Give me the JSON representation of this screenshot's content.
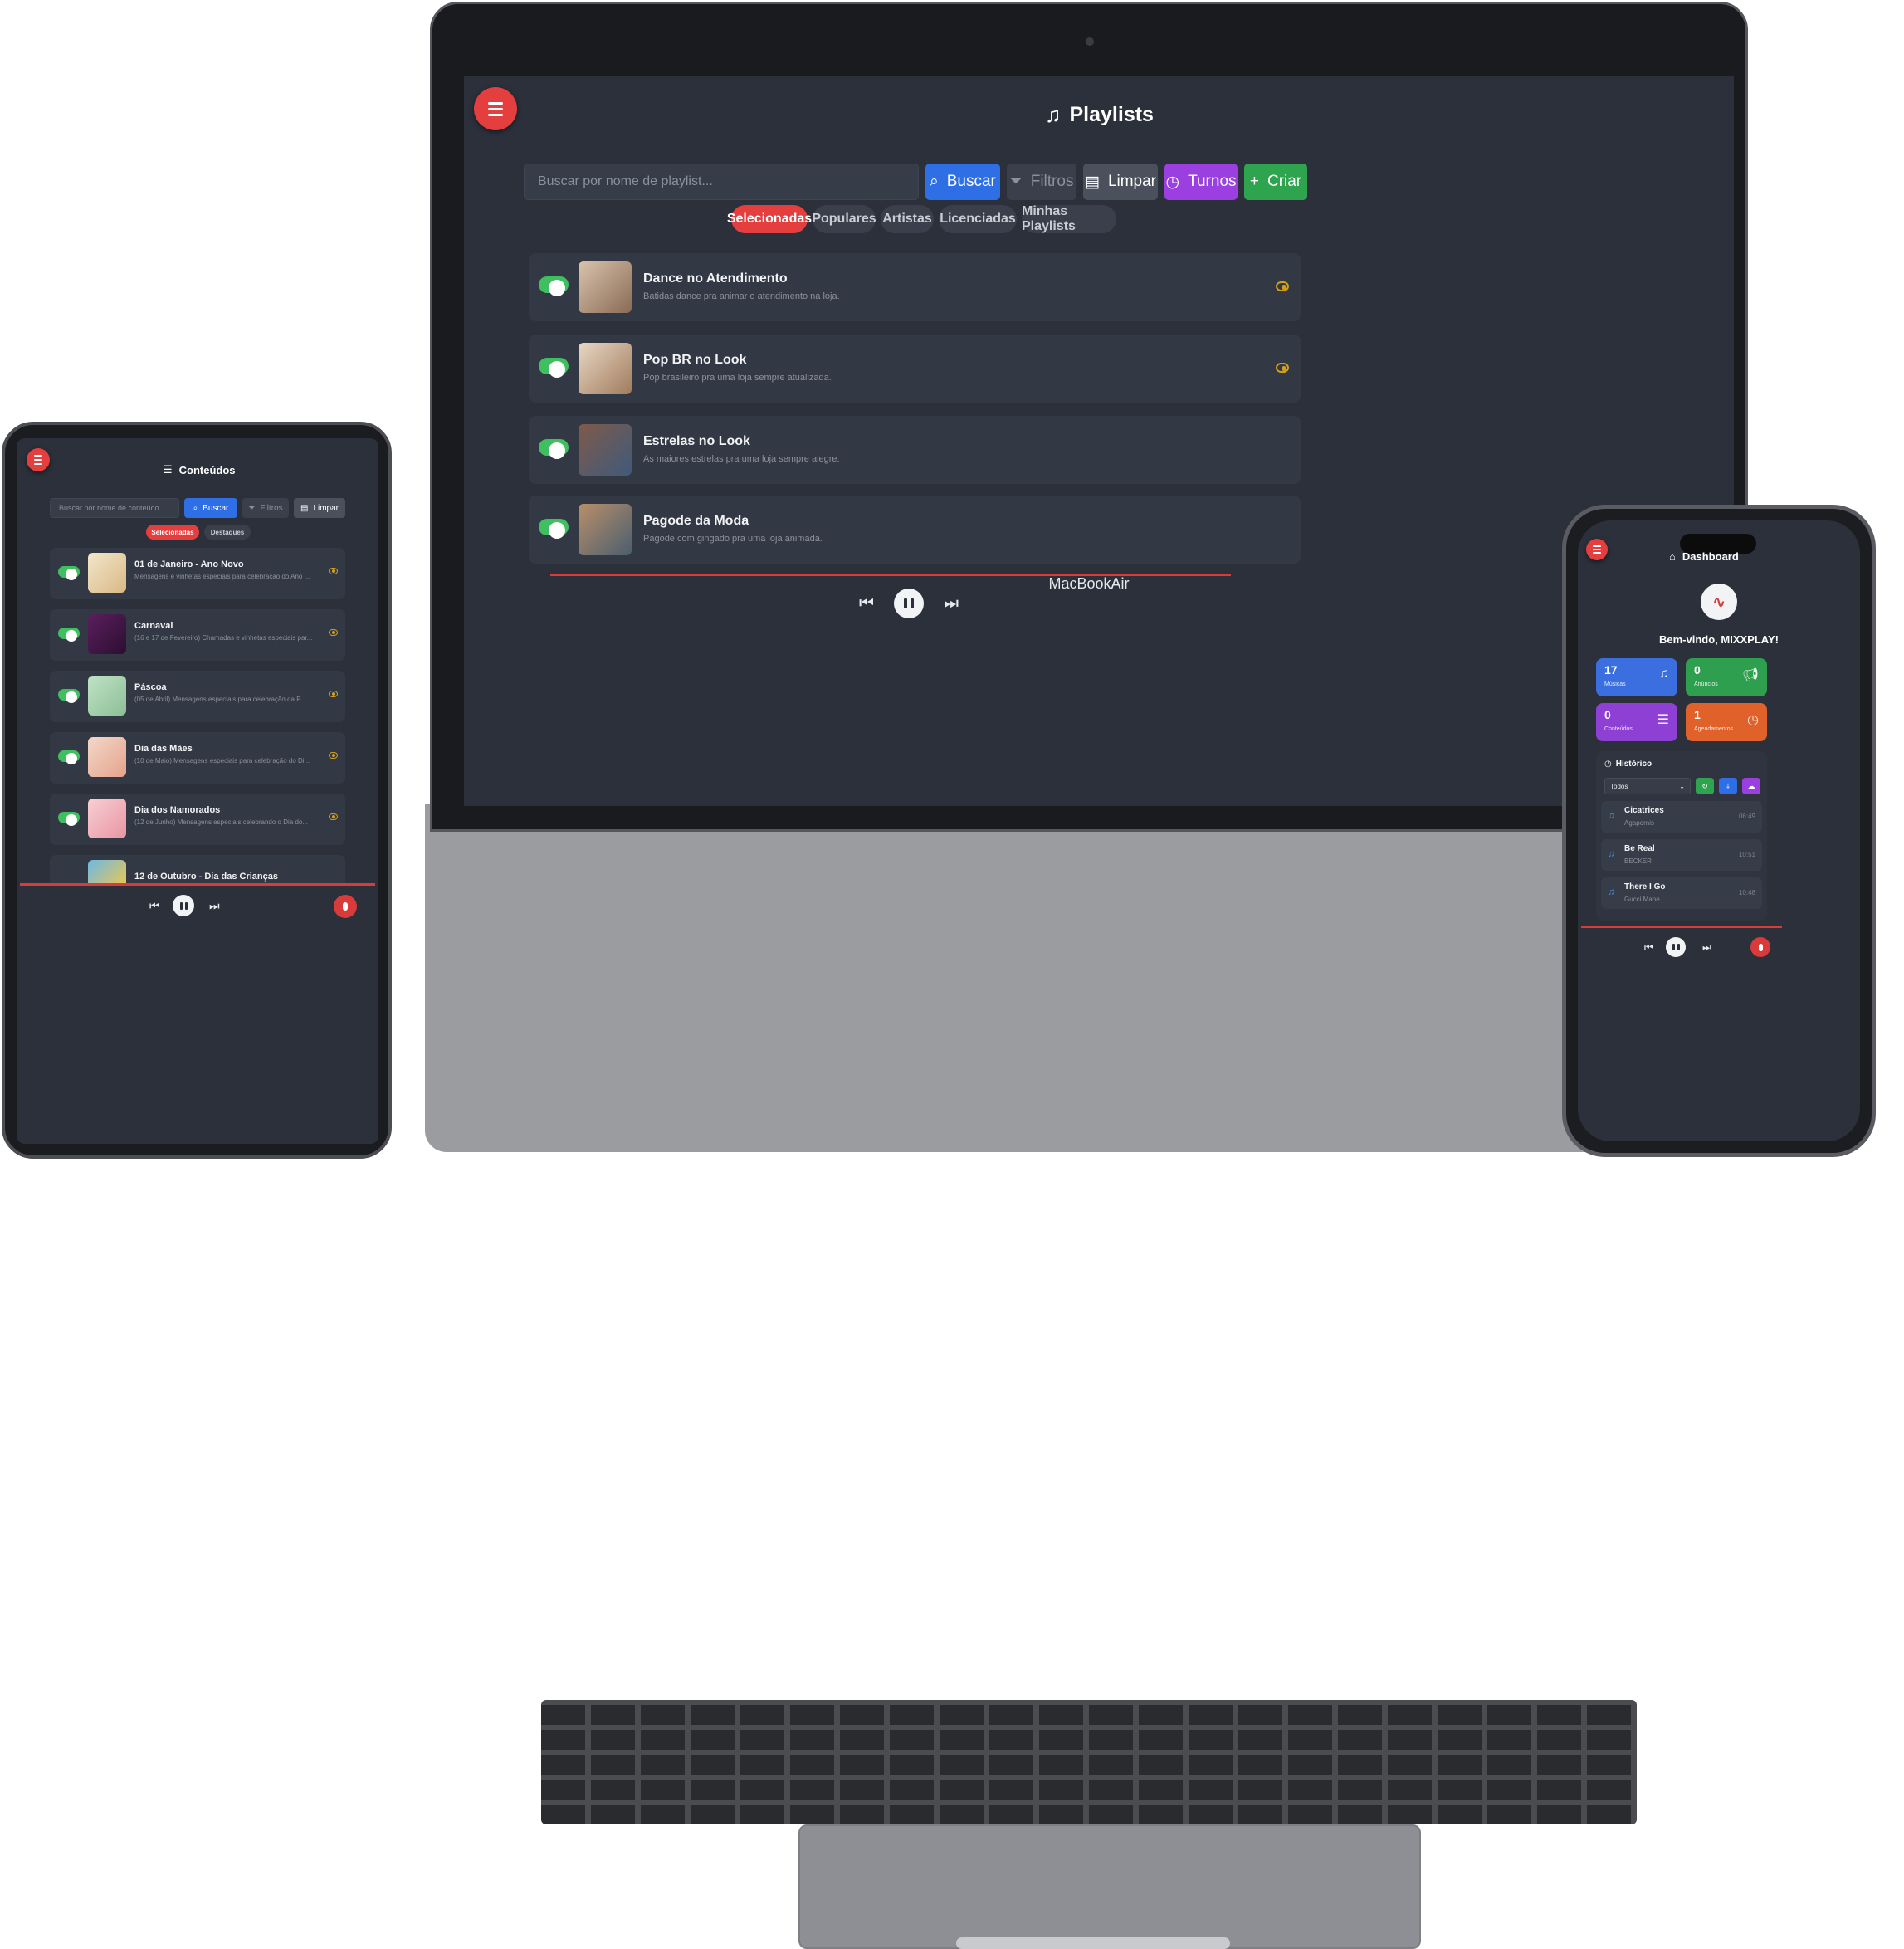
{
  "laptop": {
    "brand": "MacBookAir",
    "title": "Playlists",
    "search_placeholder": "Buscar por nome de playlist...",
    "buttons": {
      "buscar": "Buscar",
      "filtros": "Filtros",
      "limpar": "Limpar",
      "turnos": "Turnos",
      "criar": "Criar"
    },
    "tabs": [
      "Selecionadas",
      "Populares",
      "Artistas",
      "Licenciadas",
      "Minhas Playlists"
    ],
    "playlists": [
      {
        "title": "Dance no Atendimento",
        "subtitle": "Batidas dance pra animar o atendimento na loja."
      },
      {
        "title": "Pop BR no Look",
        "subtitle": "Pop brasileiro pra uma loja sempre atualizada."
      },
      {
        "title": "Estrelas no Look",
        "subtitle": "As maiores estrelas pra uma loja sempre alegre."
      },
      {
        "title": "Pagode da Moda",
        "subtitle": "Pagode com gingado pra uma loja animada."
      }
    ]
  },
  "tablet": {
    "title": "Conteúdos",
    "search_placeholder": "Buscar por nome de conteúdo...",
    "buttons": {
      "buscar": "Buscar",
      "filtros": "Filtros",
      "limpar": "Limpar"
    },
    "tabs": [
      "Selecionadas",
      "Destaques"
    ],
    "items": [
      {
        "title": "01 de Janeiro - Ano Novo",
        "subtitle": "Mensagens e vinhetas especiais para celebração do Ano ..."
      },
      {
        "title": "Carnaval",
        "subtitle": "(16 e 17 de Fevereiro) Chamadas e vinhetas especiais par..."
      },
      {
        "title": "Páscoa",
        "subtitle": "(05 de Abril) Mensagens especiais para celebração da P..."
      },
      {
        "title": "Dia das Mães",
        "subtitle": "(10 de Maio) Mensagens especiais para celebração do Di..."
      },
      {
        "title": "Dia dos Namorados",
        "subtitle": "(12 de Junho) Mensagens especiais celebrando o Dia do..."
      },
      {
        "title": "12 de Outubro - Dia das Crianças",
        "subtitle": ""
      }
    ]
  },
  "phone": {
    "title": "Dashboard",
    "welcome": "Bem-vindo, MIXXPLAY!",
    "stats": [
      {
        "value": "17",
        "label": "Músicas",
        "icon": "music-icon",
        "color": "#3b6fe0"
      },
      {
        "value": "0",
        "label": "Anúncios",
        "icon": "megaphone-icon",
        "color": "#2e9e4f"
      },
      {
        "value": "0",
        "label": "Conteúdos",
        "icon": "list-icon",
        "color": "#8e3fd4"
      },
      {
        "value": "1",
        "label": "Agendamentos",
        "icon": "clock-icon",
        "color": "#e0622a"
      }
    ],
    "history_title": "Histórico",
    "filter_value": "Todos",
    "history": [
      {
        "name": "Cicatrices",
        "artist": "Agapornis",
        "time": "06:49"
      },
      {
        "name": "Be Real",
        "artist": "BECKER",
        "time": "10:51"
      },
      {
        "name": "There I Go",
        "artist": "Gucci Mane",
        "time": "10:48"
      }
    ]
  },
  "colors": {
    "accent_red": "#e53e3e",
    "buscar_blue": "#2f6fe6",
    "turnos_purple": "#9b3fe0",
    "criar_green": "#2ea44f",
    "toggle_green": "#3fbf5f",
    "eye_gold": "#d4a017"
  }
}
